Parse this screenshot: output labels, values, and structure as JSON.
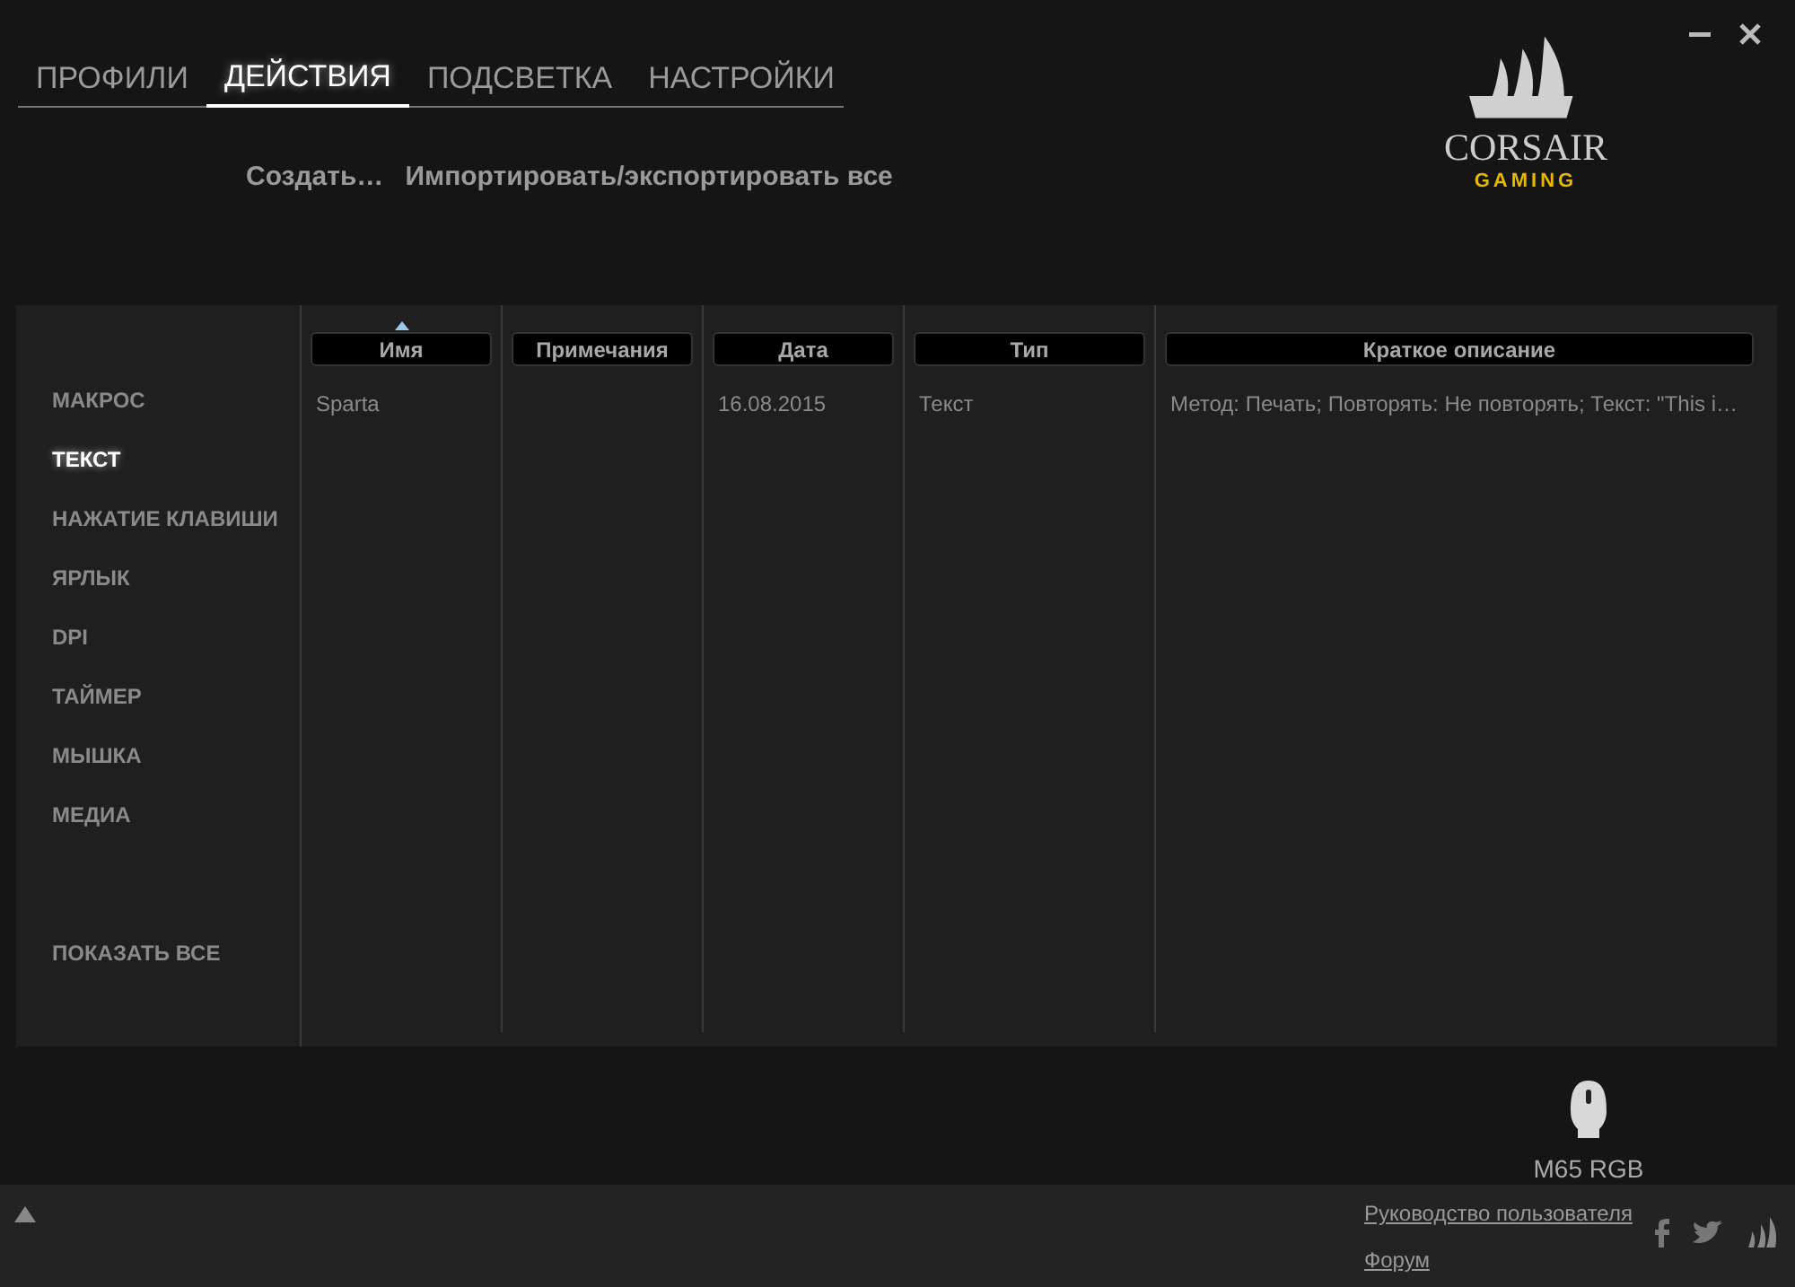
{
  "tabs": [
    {
      "label": "ПРОФИЛИ",
      "selected": false
    },
    {
      "label": "ДЕЙСТВИЯ",
      "selected": true
    },
    {
      "label": "ПОДСВЕТКА",
      "selected": false
    },
    {
      "label": "НАСТРОЙКИ",
      "selected": false
    }
  ],
  "actions": [
    "Создать…",
    "Импортировать/экспортировать все"
  ],
  "logo": {
    "brand": "CORSAIR",
    "sub": "GAMING"
  },
  "categories": [
    {
      "label": "МАКРОС",
      "selected": false
    },
    {
      "label": "ТЕКСТ",
      "selected": true
    },
    {
      "label": "НАЖАТИЕ КЛАВИШИ",
      "selected": false
    },
    {
      "label": "ЯРЛЫК",
      "selected": false
    },
    {
      "label": "DPI",
      "selected": false
    },
    {
      "label": "ТАЙМЕР",
      "selected": false
    },
    {
      "label": "МЫШКА",
      "selected": false
    },
    {
      "label": "МЕДИА",
      "selected": false
    }
  ],
  "show_all": "ПОКАЗАТЬ ВСЕ",
  "table": {
    "columns": [
      {
        "label": "Имя",
        "sorted": true
      },
      {
        "label": "Примечания",
        "sorted": false
      },
      {
        "label": "Дата",
        "sorted": false
      },
      {
        "label": "Тип",
        "sorted": false
      },
      {
        "label": "Краткое описание",
        "sorted": false
      }
    ],
    "rows": [
      [
        "Sparta",
        "",
        "16.08.2015",
        "Текст",
        "Метод: Печать; Повторять: Не повторять; Текст: \"This i…"
      ]
    ]
  },
  "device": "M65 RGB",
  "footer_links": [
    "Руководство пользователя",
    "Форум"
  ]
}
